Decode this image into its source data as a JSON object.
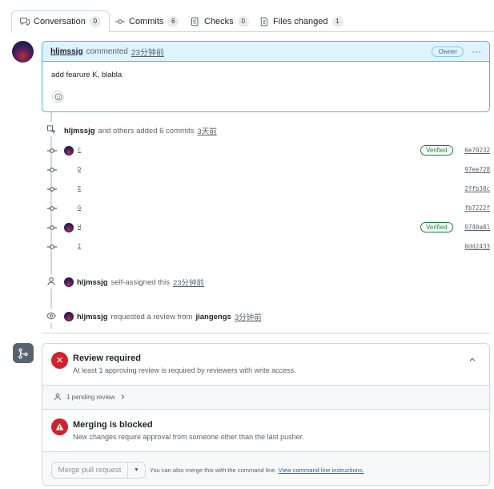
{
  "tabs": [
    {
      "label": "Conversation",
      "count": "0",
      "icon": "comment-discussion-icon"
    },
    {
      "label": "Commits",
      "count": "6",
      "icon": "git-commit-icon"
    },
    {
      "label": "Checks",
      "count": "0",
      "icon": "checklist-icon"
    },
    {
      "label": "Files changed",
      "count": "1",
      "icon": "file-diff-icon"
    }
  ],
  "comment": {
    "author": "hljmssjg",
    "action": "commented",
    "time": "23分钟前",
    "badge": "Owner",
    "menu": "···",
    "body": "add fearure K, blabla"
  },
  "commits_event": {
    "author": "hljmssjg",
    "text": "and others added 6 commits",
    "time": "3天前"
  },
  "commits": [
    {
      "message": "C",
      "sha": "6e70232",
      "verified": "Verified",
      "has_avatar": true
    },
    {
      "message": "D",
      "sha": "97ee728",
      "verified": "",
      "has_avatar": false
    },
    {
      "message": "E",
      "sha": "2ffb30c",
      "verified": "",
      "has_avatar": false
    },
    {
      "message": "G",
      "sha": "fb7222f",
      "verified": "",
      "has_avatar": false
    },
    {
      "message": "H",
      "sha": "9740a81",
      "verified": "Verified",
      "has_avatar": true
    },
    {
      "message": "I",
      "sha": "0dd2433",
      "verified": "",
      "has_avatar": false
    }
  ],
  "assign_event": {
    "author": "hljmssjg",
    "text": "self-assigned this",
    "time": "23分钟前"
  },
  "review_event": {
    "author": "hljmssjg",
    "text": "requested a review from",
    "reviewer": "jiangengs",
    "time": "3分钟前"
  },
  "merge": {
    "review_title": "Review required",
    "review_sub": "At least 1 approving review is required by reviewers with write access.",
    "pending": "1 pending review",
    "blocked_title": "Merging is blocked",
    "blocked_sub": "New changes require approval from someone other than the last pusher.",
    "button": "Merge pull request",
    "footer_text": "You can also merge this with the command line.",
    "footer_link": "View command line instructions."
  },
  "colors": {
    "accent": "#0969da",
    "danger": "#cf222e",
    "success": "#1a7f37",
    "comment_header": "#ddf4ff"
  }
}
